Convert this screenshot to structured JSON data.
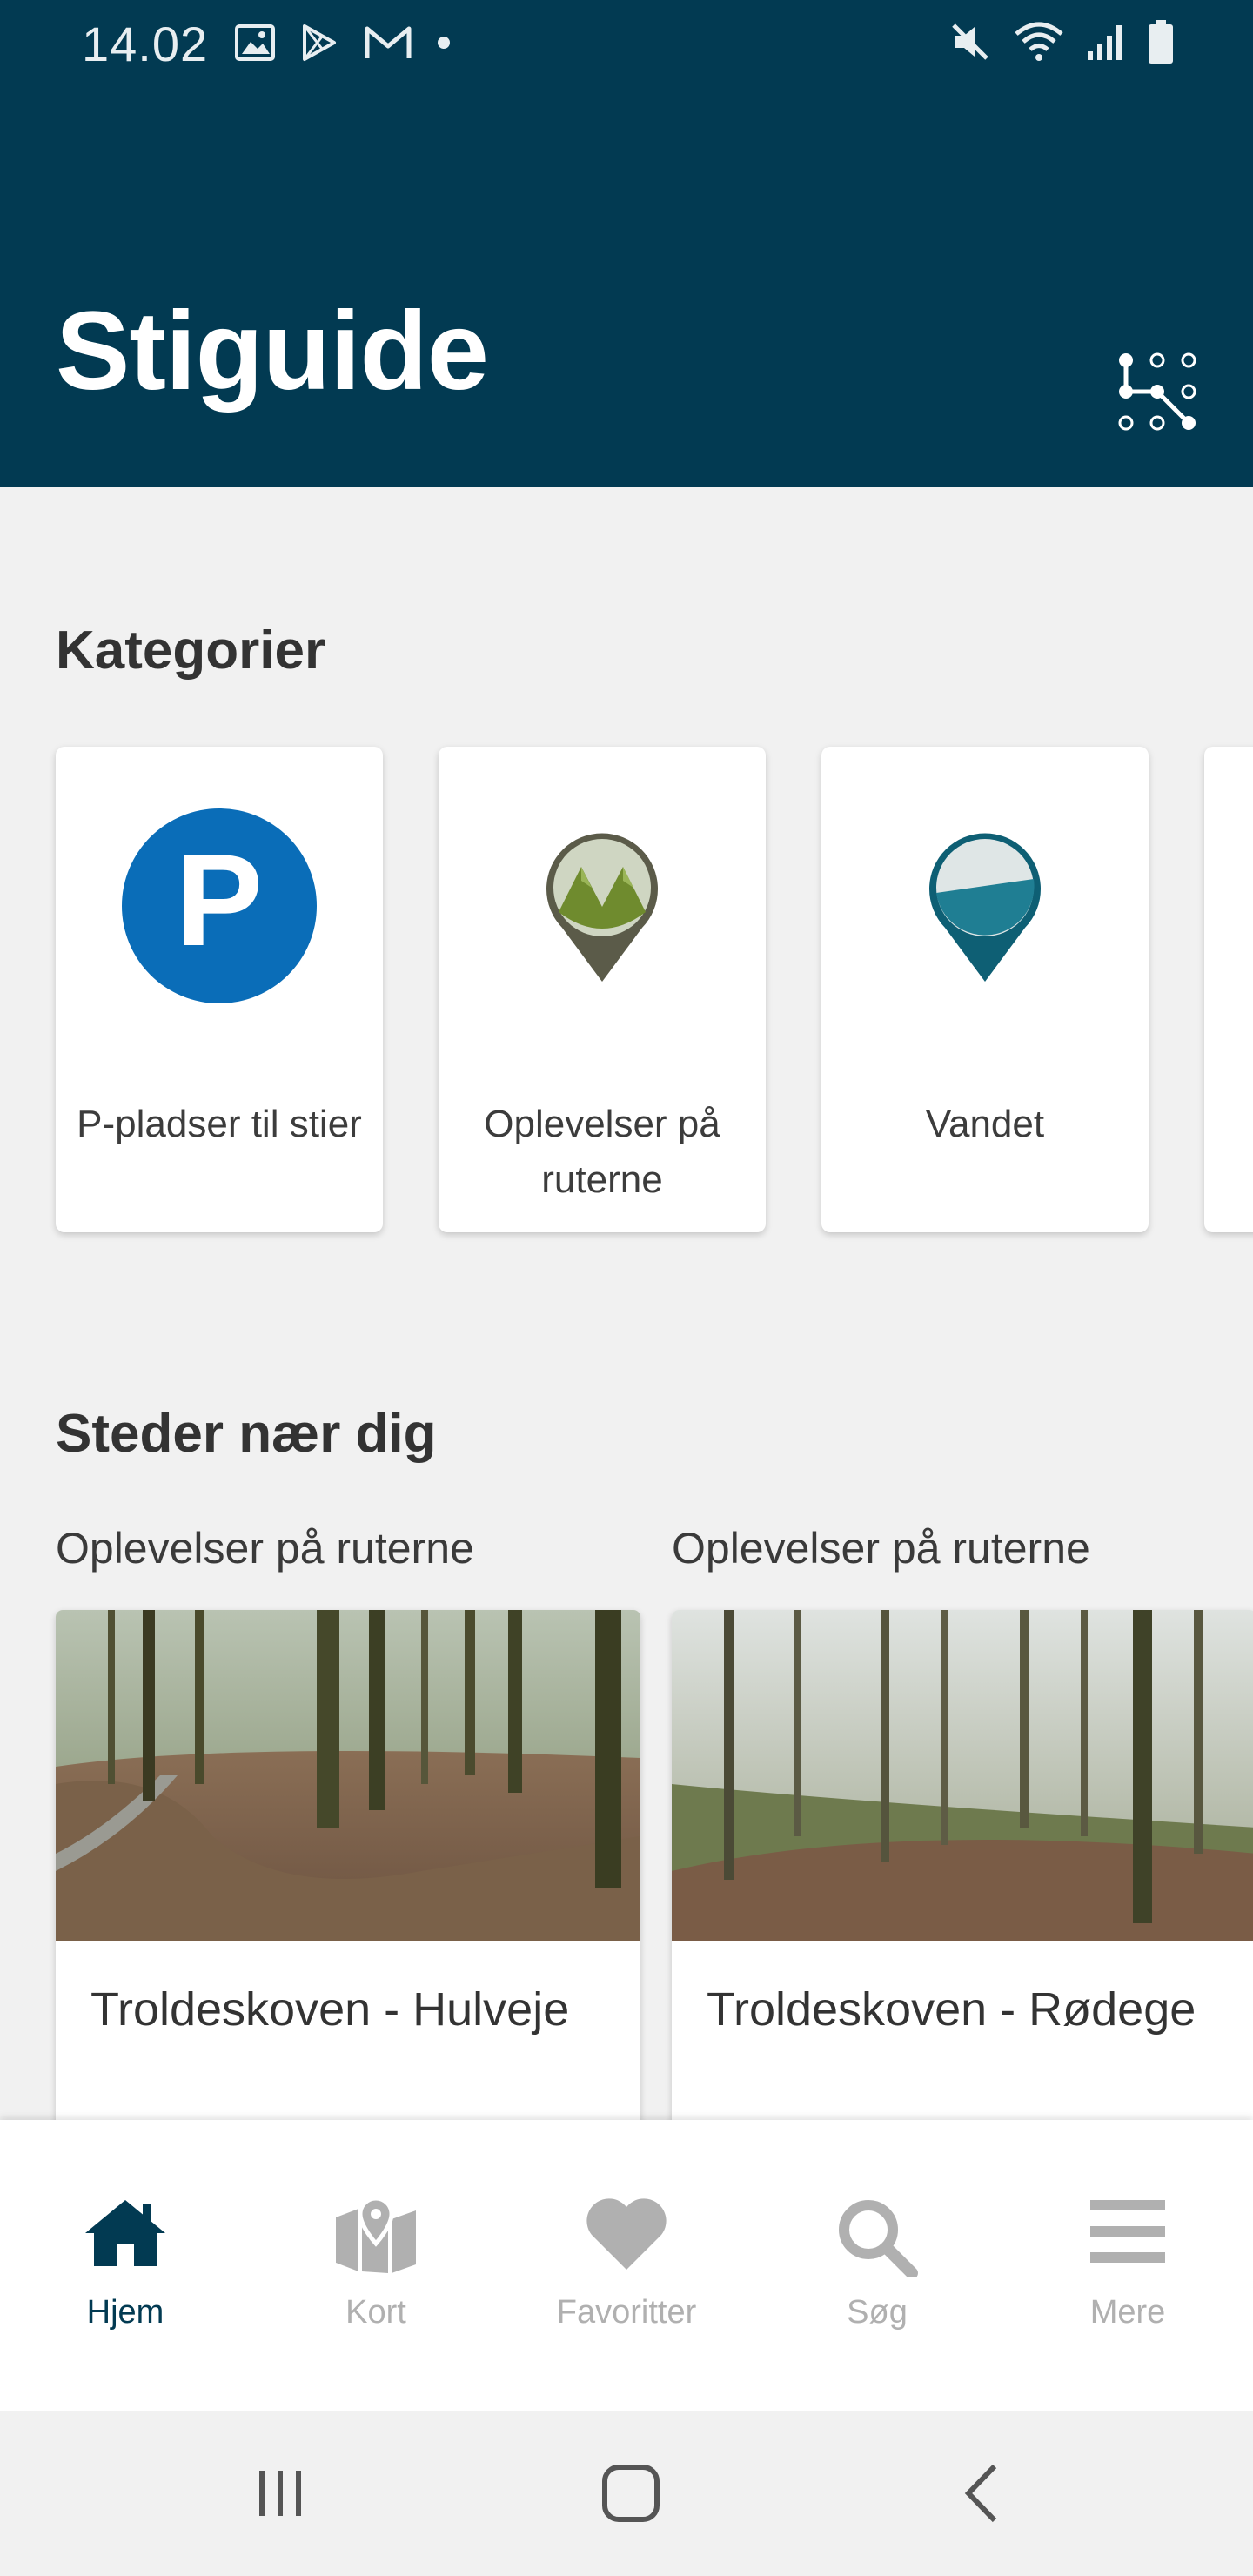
{
  "status_bar": {
    "time": "14.02",
    "left_icons": [
      "image-icon",
      "play-store-icon",
      "gmail-icon",
      "dot-icon"
    ],
    "right_icons": [
      "mute-icon",
      "wifi-icon",
      "signal-icon",
      "battery-icon"
    ]
  },
  "header": {
    "title": "Stiguide",
    "menu_icon": "dots-network-icon",
    "bg_color": "#023a52"
  },
  "categories": {
    "title": "Kategorier",
    "items": [
      {
        "label": "P-pladser til stier",
        "icon": "parking-icon"
      },
      {
        "label": "Oplevelser på ruterne",
        "icon": "mountain-pin-icon"
      },
      {
        "label": "Vandet",
        "icon": "water-pin-icon"
      }
    ]
  },
  "nearby": {
    "title": "Steder nær dig",
    "items": [
      {
        "category": "Oplevelser på ruterne",
        "title": "Troldeskoven - Hulveje"
      },
      {
        "category": "Oplevelser på ruterne",
        "title": "Troldeskoven - Rødege"
      }
    ]
  },
  "bottom_nav": {
    "items": [
      {
        "label": "Hjem",
        "icon": "home-icon",
        "active": true
      },
      {
        "label": "Kort",
        "icon": "map-icon",
        "active": false
      },
      {
        "label": "Favoritter",
        "icon": "heart-icon",
        "active": false
      },
      {
        "label": "Søg",
        "icon": "search-icon",
        "active": false
      },
      {
        "label": "Mere",
        "icon": "menu-icon",
        "active": false
      }
    ]
  },
  "colors": {
    "accent": "#023a52",
    "parking_blue": "#0a6db8",
    "inactive_nav": "#b0b0b0"
  }
}
